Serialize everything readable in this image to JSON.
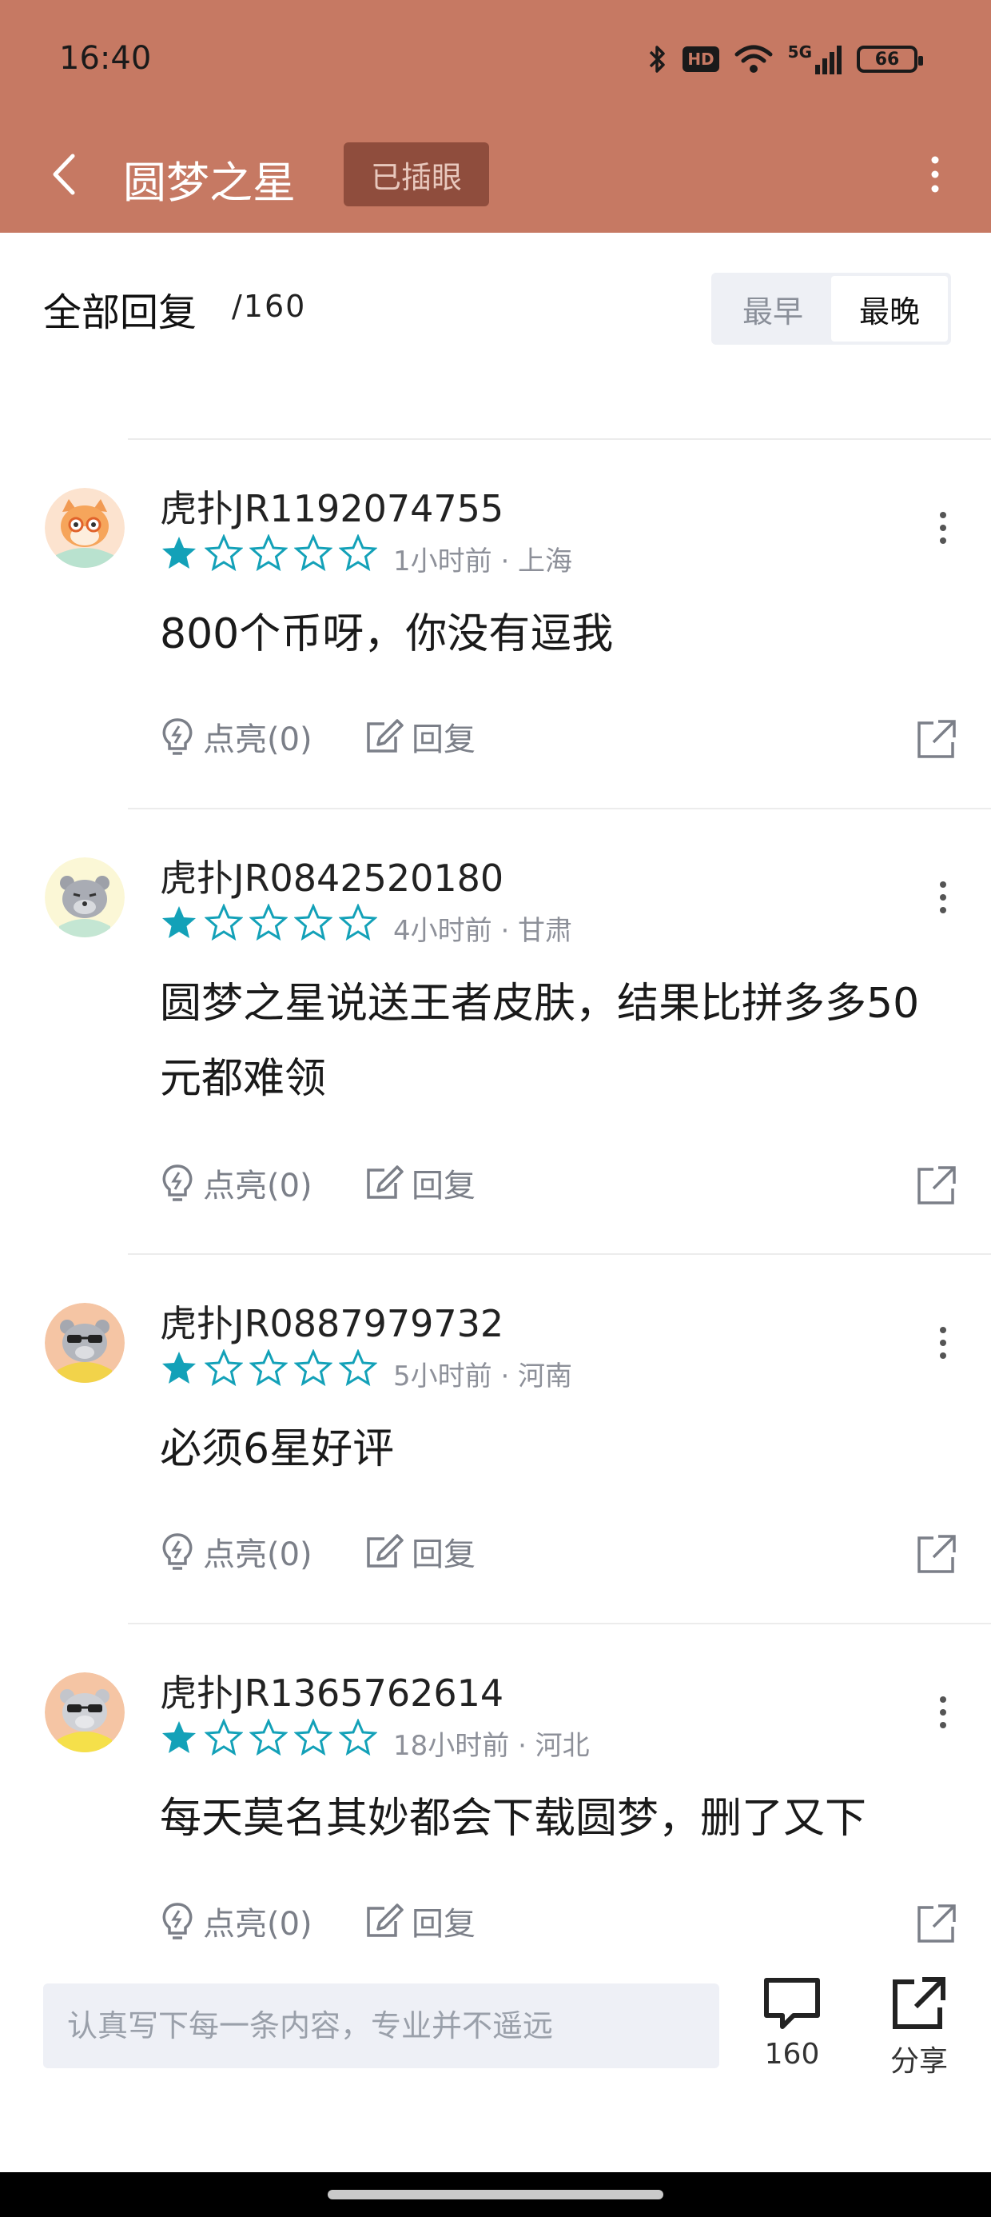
{
  "status_bar": {
    "time": "16:40",
    "hd": "HD",
    "network": "5G",
    "battery": "66"
  },
  "nav": {
    "title": "圆梦之星",
    "badge": "已插眼"
  },
  "replies": {
    "title": "全部回复",
    "count": "/160",
    "sort_options": [
      "最早",
      "最晚"
    ],
    "active_sort": "最晚"
  },
  "comments": [
    {
      "username": "虎扑JR1192074755",
      "rating": 1,
      "meta": "1小时前 · 上海",
      "text": "800个币呀，你没有逗我",
      "like_label": "点亮(0)",
      "reply_label": "回复",
      "avatar": "fox-glasses"
    },
    {
      "username": "虎扑JR0842520180",
      "rating": 1,
      "meta": "4小时前 · 甘肃",
      "text": "圆梦之星说送王者皮肤，结果比拼多多50元都难领",
      "like_label": "点亮(0)",
      "reply_label": "回复",
      "avatar": "grey-bear"
    },
    {
      "username": "虎扑JR0887979732",
      "rating": 1,
      "meta": "5小时前 · 河南",
      "text": "必须6星好评",
      "like_label": "点亮(0)",
      "reply_label": "回复",
      "avatar": "sunglasses-bear-orange"
    },
    {
      "username": "虎扑JR1365762614",
      "rating": 1,
      "meta": "18小时前 · 河北",
      "text": "每天莫名其妙都会下载圆梦，删了又下",
      "like_label": "点亮(0)",
      "reply_label": "回复",
      "avatar": "sunglasses-bear-yellow"
    }
  ],
  "bottom_bar": {
    "input_placeholder": "认真写下每一条内容，专业并不遥远",
    "comment_count": "160",
    "share_label": "分享"
  },
  "colors": {
    "header": "#c67963",
    "star": "#13a1b8",
    "muted": "#8d9099"
  }
}
